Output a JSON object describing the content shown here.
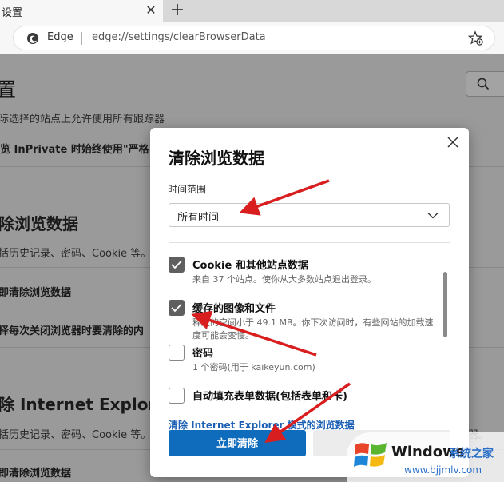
{
  "tab": {
    "title": "设置",
    "close_glyph": "✕",
    "new_tab_glyph": "+"
  },
  "address": {
    "brand": "Edge",
    "url": "edge://settings/clearBrowserData"
  },
  "background": {
    "title": "置",
    "line1": "际选择的站点上允许使用所有跟踪器",
    "line2": "览 InPrivate 时始终使用\"严格",
    "section_heading": "除浏览数据",
    "section_desc": "括历史记录、密码、Cookie 等。",
    "clear_now": "即清除浏览数据",
    "choose_on_close": "择每次关闭浏览器时要清除的内",
    "ie_heading": "除 Internet Explorer",
    "ie_desc": "括历史记录、密码、Cookie 等。",
    "ie_desc_tail": "器。",
    "ie_clear_now": "即清除浏览数据"
  },
  "dialog": {
    "title": "清除浏览数据",
    "time_range_label": "时间范围",
    "time_range_value": "所有时间",
    "options": [
      {
        "label": "Cookie 和其他站点数据",
        "desc": "来自 37 个站点。使你从大多数站点退出登录。",
        "checked": true
      },
      {
        "label": "缓存的图像和文件",
        "desc": "释放的空间小于 49.1 MB。你下次访问时，有些网站的加载速度可能会变慢。",
        "checked": true
      },
      {
        "label": "密码",
        "desc": "1 个密码(用于 kaikeyun.com)",
        "checked": false
      },
      {
        "label": "自动填充表单数据(包括表单和卡)",
        "desc": "",
        "checked": false
      }
    ],
    "ie_link": "清除 Internet Explorer 模式的浏览数据",
    "clear_button": "立即清除"
  },
  "watermark": {
    "brand": "Windows",
    "sub": "系统之家",
    "url": "www.bjjmlv.com"
  },
  "colors": {
    "accent": "#0f6cbd",
    "arrow": "#d81e1e",
    "link": "#1a5fb4"
  }
}
